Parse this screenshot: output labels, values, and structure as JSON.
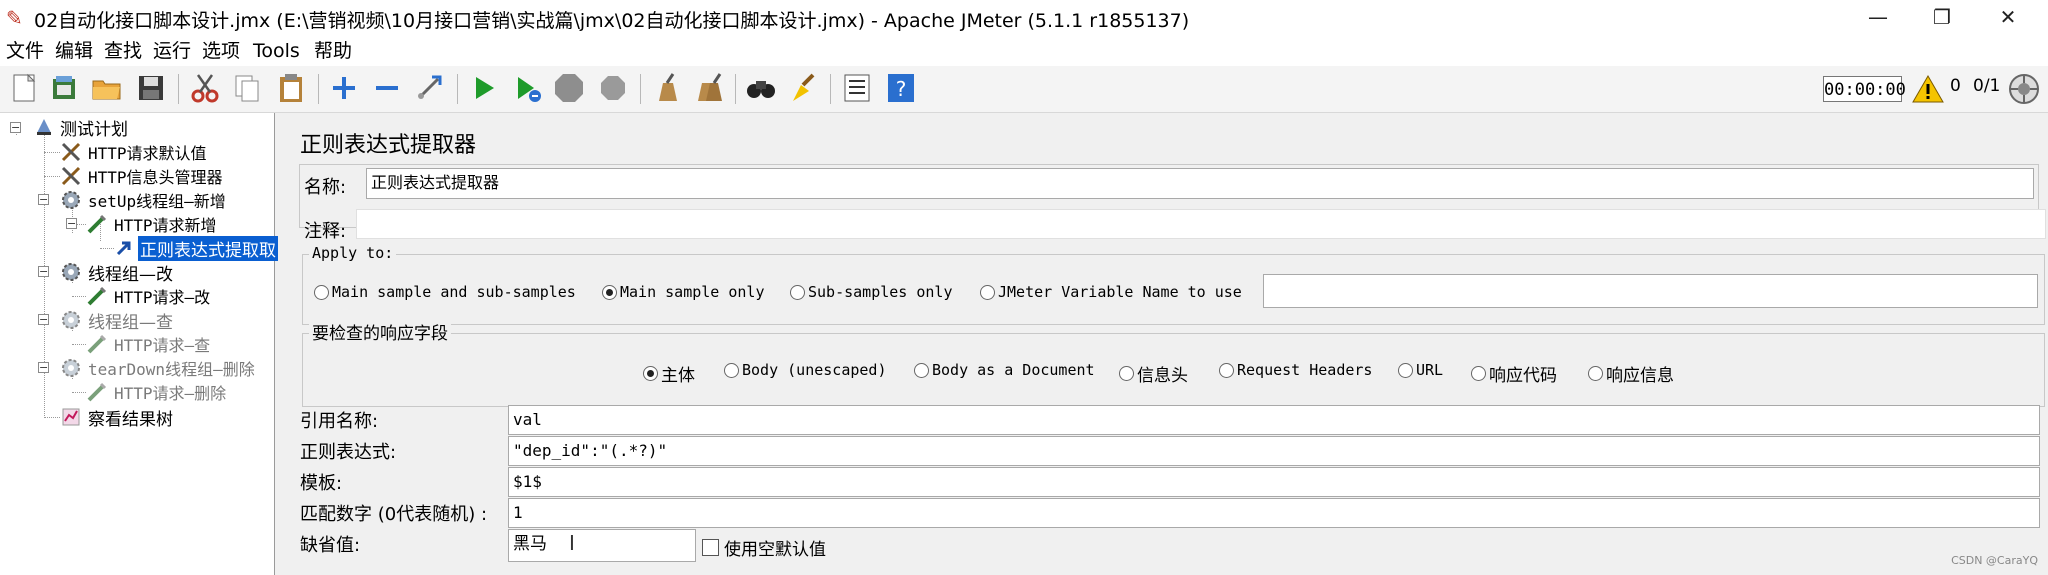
{
  "window": {
    "title": "02自动化接口脚本设计.jmx (E:\\营销视频\\10月接口营销\\实战篇\\jmx\\02自动化接口脚本设计.jmx) - Apache JMeter (5.1.1 r1855137)",
    "icon": "feather-icon",
    "minimize": "—",
    "maximize": "❐",
    "close": "✕"
  },
  "menu": [
    "文件",
    "编辑",
    "查找",
    "运行",
    "选项",
    "Tools",
    "帮助"
  ],
  "toolbar": {
    "buttons": [
      "new-icon",
      "templates-icon",
      "open-icon",
      "save-icon",
      "cut-icon",
      "copy-icon",
      "paste-icon",
      "expand-icon",
      "collapse-icon",
      "toggle-icon",
      "start-icon",
      "start-no-pauses-icon",
      "stop-icon",
      "shutdown-icon",
      "clear-icon",
      "clear-all-icon",
      "search-icon",
      "reset-search-icon",
      "function-helper-icon",
      "help-icon"
    ],
    "timer": "00:00:00",
    "warning_count": "0",
    "thread_count": "0/1"
  },
  "tree": [
    {
      "label": "测试计划",
      "icon": "test-plan-icon",
      "state": "normal"
    },
    {
      "label": "HTTP请求默认值",
      "icon": "config-tools-icon",
      "state": "normal"
    },
    {
      "label": "HTTP信息头管理器",
      "icon": "config-tools-icon",
      "state": "normal"
    },
    {
      "label": "setUp线程组—新增",
      "icon": "thread-group-gear-icon",
      "state": "normal"
    },
    {
      "label": "HTTP请求新增",
      "icon": "http-sampler-pen-icon",
      "state": "normal"
    },
    {
      "label": "正则表达式提取取",
      "icon": "post-processor-arrow-icon",
      "state": "selected"
    },
    {
      "label": "线程组—改",
      "icon": "thread-group-gear-icon",
      "state": "normal"
    },
    {
      "label": "HTTP请求—改",
      "icon": "http-sampler-pen-icon",
      "state": "normal"
    },
    {
      "label": "线程组—查",
      "icon": "thread-group-gear-icon",
      "state": "disabled"
    },
    {
      "label": "HTTP请求—查",
      "icon": "http-sampler-pen-icon",
      "state": "disabled"
    },
    {
      "label": "tearDown线程组—删除",
      "icon": "thread-group-gear-icon",
      "state": "disabled"
    },
    {
      "label": "HTTP请求—删除",
      "icon": "http-sampler-pen-icon",
      "state": "disabled"
    },
    {
      "label": "察看结果树",
      "icon": "listener-chart-icon",
      "state": "normal"
    }
  ],
  "panel": {
    "title": "正则表达式提取器",
    "name_label": "名称:",
    "name_value": "正则表达式提取器",
    "comment_label": "注释:",
    "comment_value": "",
    "apply_to": {
      "title": "Apply to:",
      "options": [
        "Main sample and sub-samples",
        "Main sample only",
        "Sub-samples only",
        "JMeter Variable Name to use"
      ],
      "selected": 1,
      "variable_value": ""
    },
    "field_to_check": {
      "title": "要检查的响应字段",
      "options": [
        "主体",
        "Body (unescaped)",
        "Body as a Document",
        "信息头",
        "Request Headers",
        "URL",
        "响应代码",
        "响应信息"
      ],
      "selected": 0
    },
    "ref_name_label": "引用名称:",
    "ref_name_value": "val",
    "regex_label": "正则表达式:",
    "regex_value": "\"dep_id\":\"(.*?)\"",
    "template_label": "模板:",
    "template_value": "$1$",
    "match_no_label": "匹配数字 (0代表随机) :",
    "match_no_value": "1",
    "default_label": "缺省值:",
    "default_value": "黑马",
    "use_empty_label": "使用空默认值",
    "use_empty_checked": false
  },
  "watermark": "CSDN @CaraYQ"
}
